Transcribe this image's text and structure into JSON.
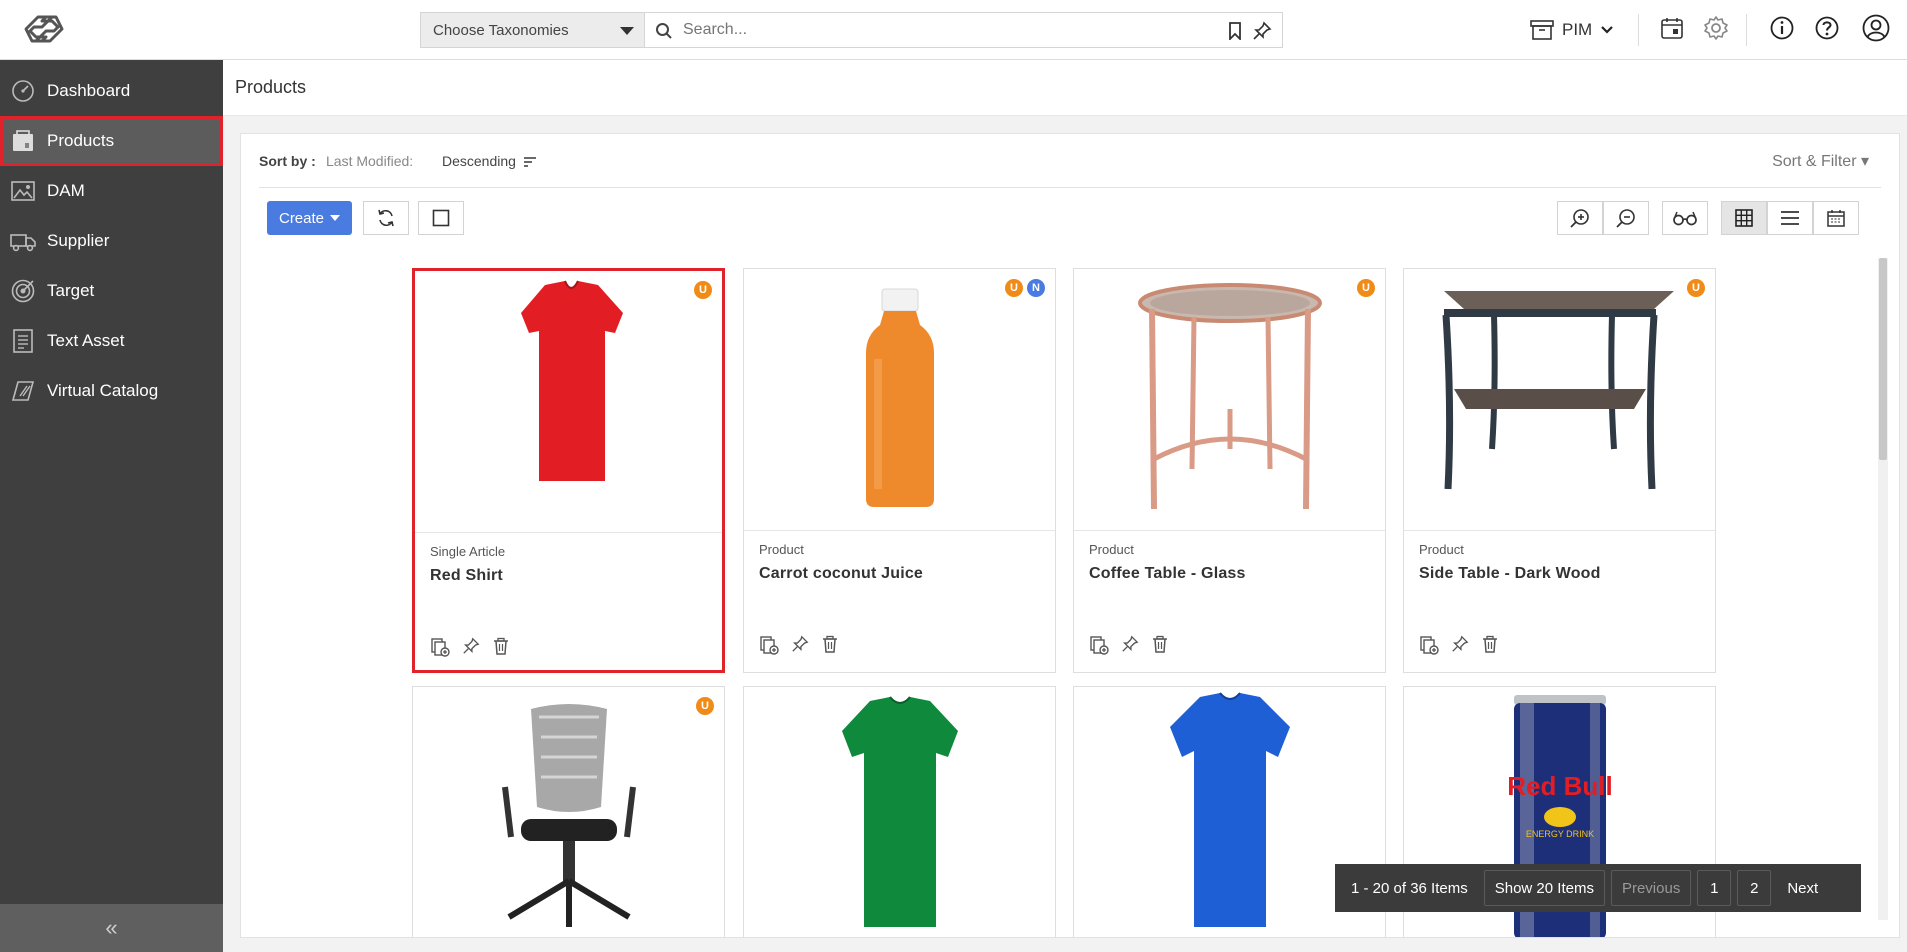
{
  "topbar": {
    "taxonomy_placeholder": "Choose Taxonomies",
    "search_placeholder": "Search...",
    "module_label": "PIM"
  },
  "sidebar": {
    "items": [
      {
        "label": "Dashboard",
        "icon": "dashboard-icon"
      },
      {
        "label": "Products",
        "icon": "products-icon",
        "active": true
      },
      {
        "label": "DAM",
        "icon": "image-icon"
      },
      {
        "label": "Supplier",
        "icon": "truck-icon"
      },
      {
        "label": "Target",
        "icon": "target-icon"
      },
      {
        "label": "Text Asset",
        "icon": "document-icon"
      },
      {
        "label": "Virtual Catalog",
        "icon": "catalog-icon"
      }
    ],
    "collapse_label": "«"
  },
  "page": {
    "title": "Products"
  },
  "sort": {
    "label": "Sort by :",
    "field": "Last Modified:",
    "order": "Descending",
    "filter_label": "Sort & Filter ▾"
  },
  "toolbar": {
    "create_label": "Create"
  },
  "cards": [
    {
      "type": "Single Article",
      "name": "Red Shirt",
      "badges": [
        "U"
      ],
      "color": "#e21d24"
    },
    {
      "type": "Product",
      "name": "Carrot coconut Juice",
      "badges": [
        "U",
        "N"
      ],
      "color": "#ef8a2c"
    },
    {
      "type": "Product",
      "name": "Coffee Table - Glass",
      "badges": [
        "U"
      ],
      "color": "#d99a86"
    },
    {
      "type": "Product",
      "name": "Side Table - Dark Wood",
      "badges": [
        "U"
      ],
      "color": "#2f3a45"
    },
    {
      "type": "",
      "name": "",
      "badges": [
        "U"
      ],
      "color": "#333333"
    },
    {
      "type": "",
      "name": "",
      "badges": [],
      "color": "#0f8a3c"
    },
    {
      "type": "",
      "name": "",
      "badges": [],
      "color": "#1f5fd6"
    },
    {
      "type": "",
      "name": "",
      "badges": [],
      "color": "#1e2f7a"
    }
  ],
  "pager": {
    "summary": "1 - 20 of 36 Items",
    "show": "Show 20 Items",
    "previous": "Previous",
    "page1": "1",
    "page2": "2",
    "next": "Next"
  },
  "redbull_text": "Red Bull",
  "redbull_sub": "ENERGY DRINK"
}
